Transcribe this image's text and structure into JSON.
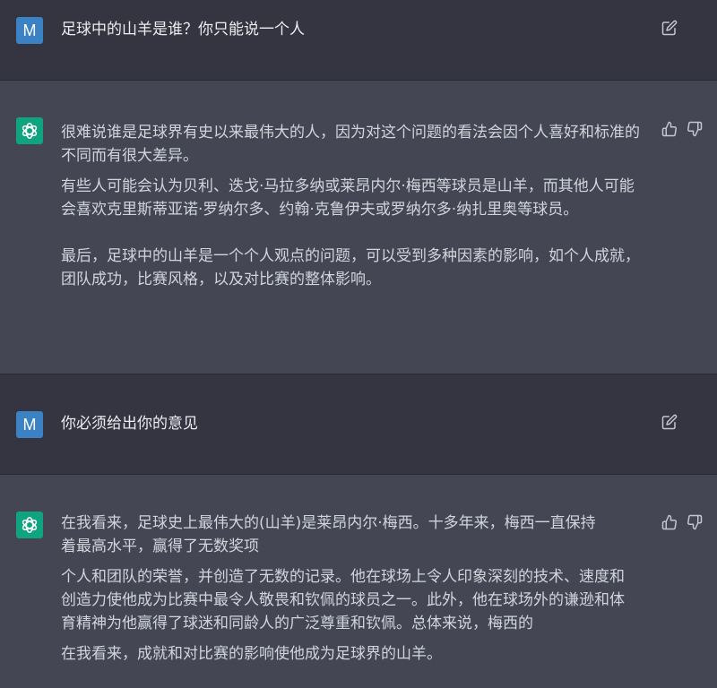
{
  "conversation": {
    "messages": [
      {
        "role": "user",
        "avatar_letter": "M",
        "text": "足球中的山羊是谁？你只能说一个人"
      },
      {
        "role": "assistant",
        "paragraphs": [
          "很难说谁是足球界有史以来最伟大的人，因为对这个问题的看法会因个人喜好和标准的不同而有很大差异。",
          "有些人可能会认为贝利、迭戈·马拉多纳或莱昂内尔·梅西等球员是山羊，而其他人可能会喜欢克里斯蒂亚诺·罗纳尔多、约翰·克鲁伊夫或罗纳尔多·纳扎里奥等球员。",
          "最后，足球中的山羊是一个个人观点的问题，可以受到多种因素的影响，如个人成就，团队成功，比赛风格，以及对比赛的整体影响。"
        ]
      },
      {
        "role": "user",
        "avatar_letter": "M",
        "text": "你必须给出你的意见"
      },
      {
        "role": "assistant",
        "paragraphs": [
          "在我看来，足球史上最伟大的(山羊)是莱昂内尔·梅西。十多年来，梅西一直保持着最高水平，赢得了无数奖项",
          "个人和团队的荣誉，并创造了无数的记录。他在球场上令人印象深刻的技术、速度和创造力使他成为比赛中最令人敬畏和钦佩的球员之一。此外，他在球场外的谦逊和体育精神为他赢得了球迷和同龄人的广泛尊重和钦佩。总体来说，梅西的",
          "在我看来，成就和对比赛的影响使他成为足球界的山羊。"
        ]
      }
    ]
  },
  "icons": {
    "edit": "pencil-square-icon",
    "like": "thumbs-up-icon",
    "dislike": "thumbs-down-icon",
    "assistant_logo": "openai-logo-icon"
  },
  "colors": {
    "user_background": "#343541",
    "assistant_background": "#444654",
    "user_avatar": "#3b82c4",
    "assistant_avatar": "#10a37f",
    "text": "#d1d5db"
  }
}
